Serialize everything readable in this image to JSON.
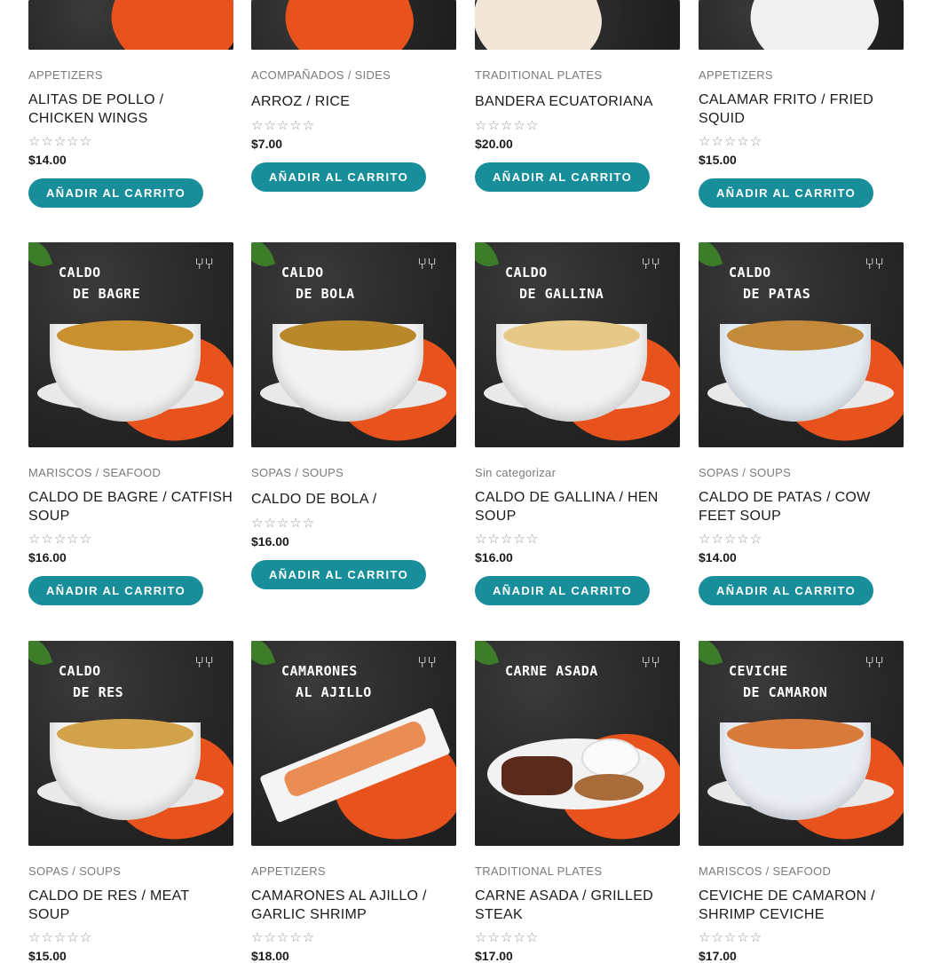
{
  "colors": {
    "button": "#188e9a",
    "accent_blob": "#e8521c",
    "chalkboard": "#2b2b2b"
  },
  "rating_stars_icon": "star-outline-icon",
  "products": [
    {
      "category": "APPETIZERS",
      "name": "ALITAS DE POLLO / CHICKEN WINGS",
      "price": "$14.00",
      "button": "AÑADIR AL CARRITO"
    },
    {
      "category": "ACOMPAÑADOS / SIDES",
      "name": "ARROZ / RICE",
      "price": "$7.00",
      "button": "AÑADIR AL CARRITO"
    },
    {
      "category": "TRADITIONAL PLATES",
      "name": "BANDERA ECUATORIANA",
      "price": "$20.00",
      "button": "AÑADIR AL CARRITO"
    },
    {
      "category": "APPETIZERS",
      "name": "CALAMAR FRITO / FRIED SQUID",
      "price": "$15.00",
      "button": "AÑADIR AL CARRITO"
    },
    {
      "img_title": [
        "CALDO",
        "DE BAGRE"
      ],
      "category": "MARISCOS / SEAFOOD",
      "name": "CALDO DE BAGRE / CATFISH SOUP",
      "price": "$16.00",
      "button": "AÑADIR AL CARRITO"
    },
    {
      "img_title": [
        "CALDO",
        "DE BOLA"
      ],
      "category": "SOPAS / SOUPS",
      "name": "CALDO DE BOLA /",
      "price": "$16.00",
      "button": "AÑADIR AL CARRITO"
    },
    {
      "img_title": [
        "CALDO",
        "DE GALLINA"
      ],
      "category": "Sin categorizar",
      "name": "CALDO DE GALLINA / HEN SOUP",
      "price": "$16.00",
      "button": "AÑADIR AL CARRITO"
    },
    {
      "img_title": [
        "CALDO",
        "DE PATAS"
      ],
      "category": "SOPAS / SOUPS",
      "name": "CALDO DE PATAS / COW FEET SOUP",
      "price": "$14.00",
      "button": "AÑADIR AL CARRITO"
    },
    {
      "img_title": [
        "CALDO",
        "DE RES"
      ],
      "category": "SOPAS / SOUPS",
      "name": "CALDO DE RES / MEAT SOUP",
      "price": "$15.00"
    },
    {
      "img_title": [
        "CAMARONES",
        "AL AJILLO"
      ],
      "category": "APPETIZERS",
      "name": "CAMARONES AL AJILLO / GARLIC SHRIMP",
      "price": "$18.00"
    },
    {
      "img_title": [
        "CARNE ASADA"
      ],
      "category": "TRADITIONAL PLATES",
      "name": "CARNE ASADA / GRILLED STEAK",
      "price": "$17.00"
    },
    {
      "img_title": [
        "CEVICHE",
        "DE CAMARON"
      ],
      "category": "MARISCOS / SEAFOOD",
      "name": "CEVICHE DE CAMARON / SHRIMP CEVICHE",
      "price": "$17.00"
    }
  ]
}
